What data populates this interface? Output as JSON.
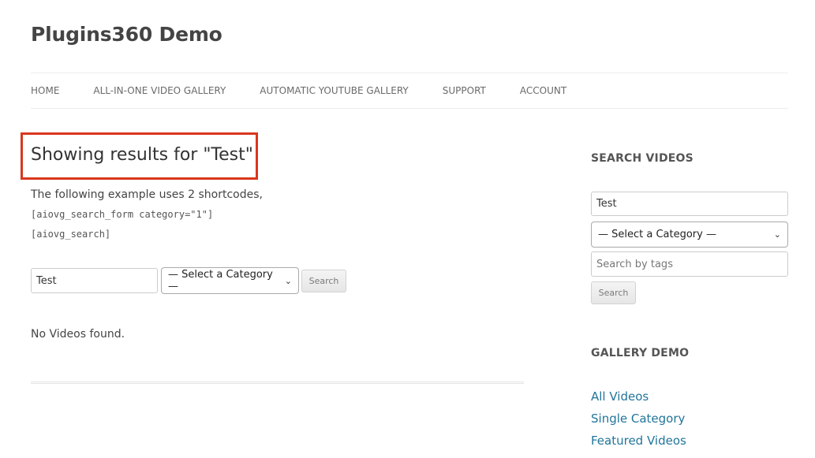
{
  "site": {
    "title": "Plugins360 Demo"
  },
  "nav": {
    "items": [
      {
        "label": "HOME"
      },
      {
        "label": "ALL-IN-ONE VIDEO GALLERY"
      },
      {
        "label": "AUTOMATIC YOUTUBE GALLERY"
      },
      {
        "label": "SUPPORT"
      },
      {
        "label": "ACCOUNT"
      }
    ]
  },
  "main": {
    "results_title": "Showing results for \"Test\"",
    "intro": "The following example uses 2 shortcodes,",
    "shortcodes": [
      "[aiovg_search_form category=\"1\"]",
      "[aiovg_search]"
    ],
    "search_form": {
      "query_value": "Test",
      "category_selected": "— Select a Category —",
      "search_button": "Search"
    },
    "no_results": "No Videos found."
  },
  "sidebar": {
    "search_widget": {
      "title": "SEARCH VIDEOS",
      "query_value": "Test",
      "category_selected": "— Select a Category —",
      "tags_placeholder": "Search by tags",
      "search_button": "Search"
    },
    "gallery_widget": {
      "title": "GALLERY DEMO",
      "links": [
        {
          "label": "All Videos"
        },
        {
          "label": "Single Category"
        },
        {
          "label": "Featured Videos"
        }
      ]
    }
  },
  "colors": {
    "highlight_border": "#d9371f",
    "link": "#21759b",
    "text": "#444444"
  }
}
